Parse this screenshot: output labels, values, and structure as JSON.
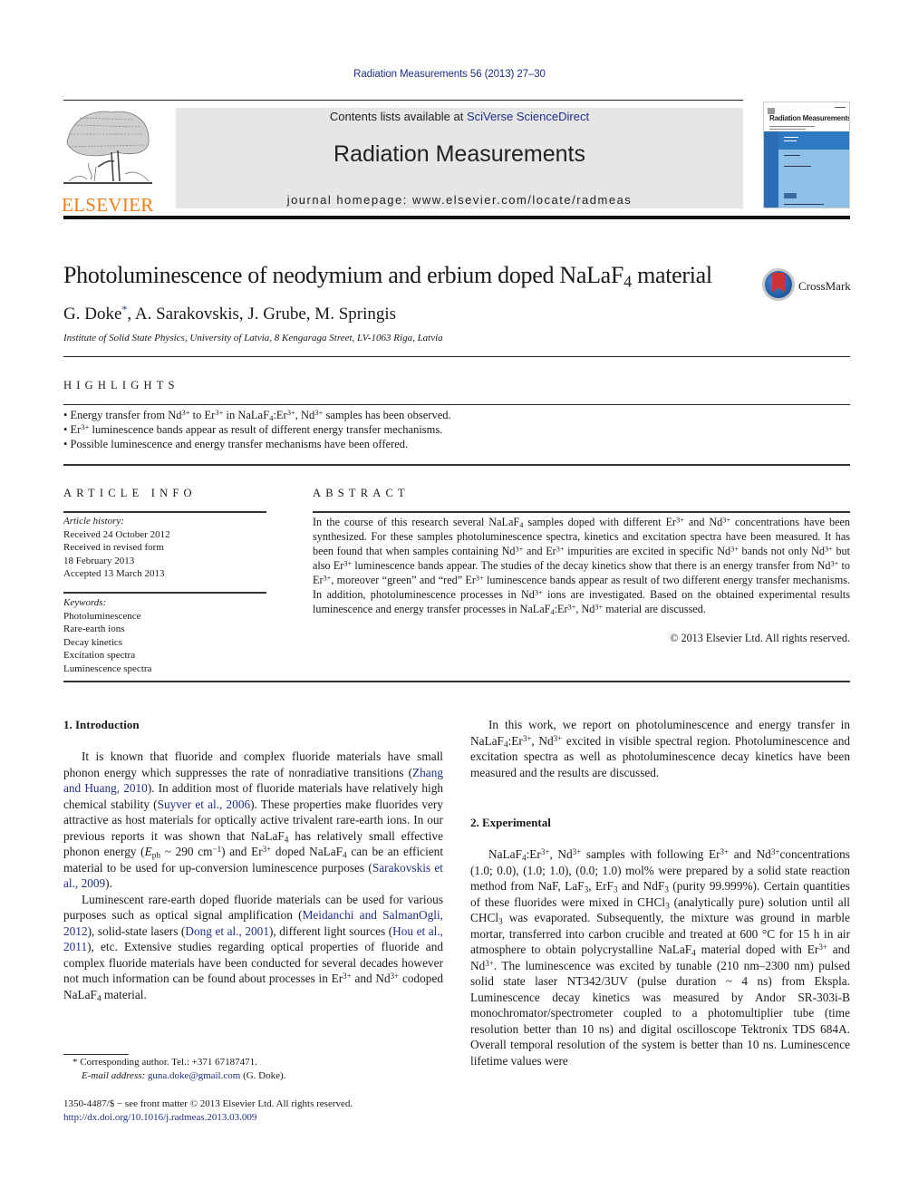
{
  "citation": "Radiation Measurements 56 (2013) 27–30",
  "publisher": {
    "name": "ELSEVIER",
    "logo_icon": "elsevier-tree-icon"
  },
  "masthead": {
    "contents_prefix": "Contents lists available at ",
    "contents_link": "SciVerse ScienceDirect",
    "journal_title": "Radiation Measurements",
    "homepage_prefix": "journal homepage: ",
    "homepage_url": "www.elsevier.com/locate/radmeas"
  },
  "cover": {
    "title": "Radiation Measurements",
    "band_color": "#2f79c2",
    "light_color": "#8ec0e8"
  },
  "article": {
    "title_main": "Photoluminescence of neodymium and erbium doped NaLaF",
    "title_sub": "4",
    "title_tail": " material",
    "crossmark_label": "CrossMark",
    "authors": [
      {
        "name": "G. Doke",
        "mark": "*"
      },
      {
        "name": "A. Sarakovskis"
      },
      {
        "name": "J. Grube"
      },
      {
        "name": "M. Springis"
      }
    ],
    "author_sep": ", ",
    "affiliation": "Institute of Solid State Physics, University of Latvia, 8 Kengaraga Street, LV-1063 Riga, Latvia"
  },
  "highlights": {
    "heading": "HIGHLIGHTS",
    "items": [
      "Energy transfer from Nd^3+ to Er^3+ in NaLaF_4:Er^3+, Nd^3+ samples has been observed.",
      "Er^3+ luminescence bands appear as result of different energy transfer mechanisms.",
      "Possible luminescence and energy transfer mechanisms have been offered."
    ]
  },
  "article_info": {
    "heading": "ARTICLE INFO",
    "history_label": "Article history:",
    "history": [
      "Received 24 October 2012",
      "Received in revised form",
      "18 February 2013",
      "Accepted 13 March 2013"
    ],
    "keywords_label": "Keywords:",
    "keywords": [
      "Photoluminescence",
      "Rare-earth ions",
      "Decay kinetics",
      "Excitation spectra",
      "Luminescence spectra"
    ]
  },
  "abstract": {
    "heading": "ABSTRACT",
    "text": "In the course of this research several NaLaF_4 samples doped with different Er^3+ and Nd^3+ concentrations have been synthesized. For these samples photoluminescence spectra, kinetics and excitation spectra have been measured. It has been found that when samples containing Nd^3+ and Er^3+ impurities are excited in specific Nd^3+ bands not only Nd^3+ but also Er^3+ luminescence bands appear. The studies of the decay kinetics show that there is an energy transfer from Nd^3+ to Er^3+, moreover “green” and “red” Er^3+ luminescence bands appear as result of two different energy transfer mechanisms. In addition, photo­luminescence processes in Nd^3+ ions are investigated. Based on the obtained experimental results luminescence and energy transfer processes in NaLaF_4:Er^3+, Nd^3+ material are discussed.",
    "copyright": "© 2013 Elsevier Ltd. All rights reserved."
  },
  "sections": {
    "intro_heading": "1.  Introduction",
    "intro_paragraphs": [
      "It is known that fluoride and complex fluoride materials have small phonon energy which suppresses the rate of nonradiative transitions ([Zhang and Huang, 2010]). In addition most of fluoride materials have relatively high chemical stability ([Suyver et al., 2006]). These properties make fluorides very attractive as host materials for optically active trivalent rare-earth ions. In our pre­vious reports it was shown that NaLaF_4 has relatively small effective phonon energy (E_ph ~ 290 cm^−1) and Er^3+ doped NaLaF_4 can be an efficient material to be used for up-conversion luminescence pur­poses ([Sarakovskis et al., 2009]).",
      "Luminescent rare-earth doped fluoride materials can be used for various purposes such as optical signal amplification ([Meidanchi and SalmanOgli, 2012]), solid-state lasers ([Dong et al., 2001]), different light sources ([Hou et al., 2011]), etc. Extensive studies regarding optical properties of fluoride and complex fluoride ma­terials have been conducted for several decades however not much information can be found about processes in Er^3+ and Nd^3+ codo­ped NaLaF_4 material."
    ],
    "intro_cont_paragraph": "In this work, we report on photoluminescence and energy transfer in NaLaF_4:Er^3+, Nd^3+ excited in visible spectral region. Photoluminescence and excitation spectra as well as photo­luminescence decay kinetics have been measured and the results are discussed.",
    "exp_heading": "2.  Experimental",
    "exp_paragraph": "NaLaF_4:Er^3+, Nd^3+ samples with following Er^3+ and Nd^3+con­centrations (1.0; 0.0), (1.0; 1.0), (0.0; 1.0) mol% were prepared by a solid state reaction method from NaF, LaF_3, ErF_3 and NdF_3 (purity 99.999%). Certain quantities of these fluorides were mixed in CHCl_3 (analytically pure) solution until all CHCl_3 was evaporated. Subse­quently, the mixture was ground in marble mortar, transferred into carbon crucible and treated at 600 °C for 15 h in air atmosphere to obtain polycrystalline NaLaF_4 material doped with Er^3+ and Nd^3+. The luminescence was excited by tunable (210 nm–2300 nm) pulsed solid state laser NT342/3UV (pulse duration ~ 4 ns) from Ekspla. Luminescence decay kinetics was measured by Andor SR-303i-B monochromator/spectrometer coupled to a photo­multiplier tube (time resolution better than 10 ns) and digital oscilloscope Tektronix TDS 684A. Overall temporal resolution of the system is better than 10 ns. Luminescence lifetime values were"
  },
  "footnotes": {
    "corresponding": "* Corresponding author. Tel.: +371 67187471.",
    "email_label": "E-mail address: ",
    "email": "guna.doke@gmail.com",
    "email_suffix": " (G. Doke).",
    "front_matter": "1350-4487/$ − see front matter © 2013 Elsevier Ltd. All rights reserved.",
    "doi": "http://dx.doi.org/10.1016/j.radmeas.2013.03.009"
  }
}
